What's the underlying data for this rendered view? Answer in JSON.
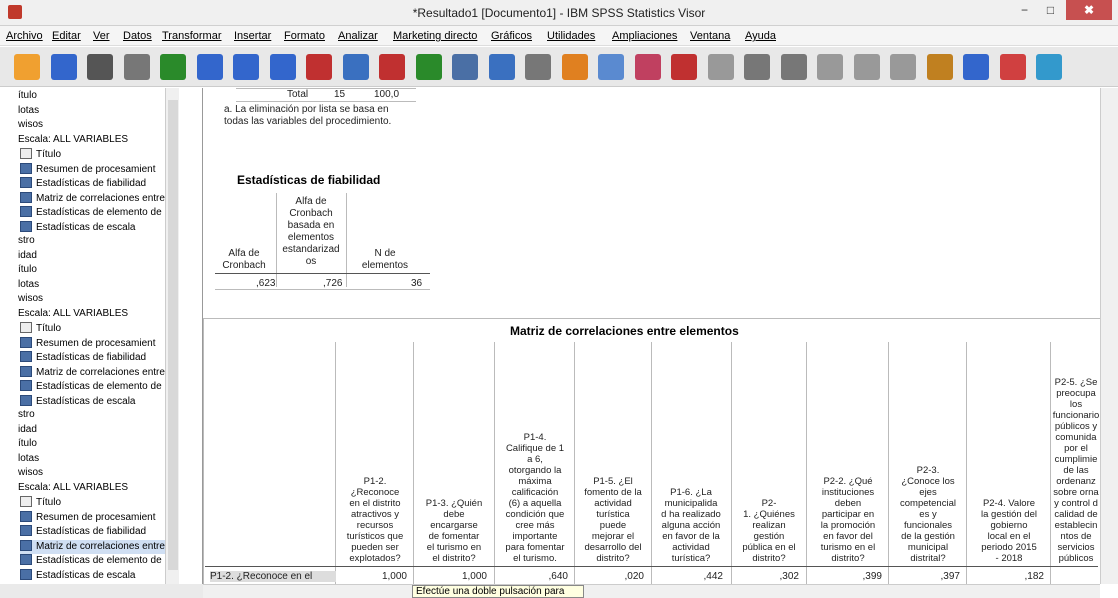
{
  "window": {
    "title": "*Resultado1 [Documento1] - IBM SPSS Statistics Visor",
    "btn_min": "−",
    "btn_max": "□",
    "btn_close": "✖"
  },
  "menu": [
    "Archivo",
    "Editar",
    "Ver",
    "Datos",
    "Transformar",
    "Insertar",
    "Formato",
    "Analizar",
    "Marketing directo",
    "Gráficos",
    "Utilidades",
    "Ampliaciones",
    "Ventana",
    "Ayuda"
  ],
  "toolbar_icons": [
    "open-icon",
    "save-icon",
    "print-icon",
    "print-preview-icon",
    "export-icon",
    "recall-dialog-icon",
    "undo-icon",
    "redo-icon",
    "goto-data-icon",
    "goto-case-icon",
    "goto-variable-icon",
    "variables-icon",
    "use-sets-icon",
    "show-all-icon",
    "insert-cases-icon",
    "designate-window-icon",
    "run-script-icon",
    "insert-output-icon",
    "insert-heading-icon",
    "insert-title-icon",
    "promote-icon",
    "demote-icon",
    "expand-icon",
    "collapse-icon",
    "show-icon",
    "hide-icon",
    "script-icon",
    "dialog-icon",
    "chart-icon"
  ],
  "nav": {
    "items": [
      {
        "label": "ítulo",
        "type": "text"
      },
      {
        "label": "lotas",
        "type": "text"
      },
      {
        "label": "wisos",
        "type": "text"
      },
      {
        "label": "Escala: ALL VARIABLES",
        "type": "text"
      },
      {
        "label": "Título",
        "type": "child"
      },
      {
        "label": "Resumen de procesamient",
        "type": "table"
      },
      {
        "label": "Estadísticas de fiabilidad",
        "type": "table"
      },
      {
        "label": "Matriz de correlaciones entre",
        "type": "table"
      },
      {
        "label": "Estadísticas de elemento de",
        "type": "table"
      },
      {
        "label": "Estadísticas de escala",
        "type": "table"
      },
      {
        "label": "stro",
        "type": "text"
      },
      {
        "label": "idad",
        "type": "text"
      },
      {
        "label": "ítulo",
        "type": "text"
      },
      {
        "label": "lotas",
        "type": "text"
      },
      {
        "label": "wisos",
        "type": "text"
      },
      {
        "label": "Escala: ALL VARIABLES",
        "type": "text"
      },
      {
        "label": "Título",
        "type": "child"
      },
      {
        "label": "Resumen de procesamient",
        "type": "table"
      },
      {
        "label": "Estadísticas de fiabilidad",
        "type": "table"
      },
      {
        "label": "Matriz de correlaciones entre",
        "type": "table"
      },
      {
        "label": "Estadísticas de elemento de",
        "type": "table"
      },
      {
        "label": "Estadísticas de escala",
        "type": "table"
      },
      {
        "label": "stro",
        "type": "text"
      },
      {
        "label": "idad",
        "type": "text"
      },
      {
        "label": "ítulo",
        "type": "text"
      },
      {
        "label": "lotas",
        "type": "text"
      },
      {
        "label": "wisos",
        "type": "text"
      },
      {
        "label": "Escala: ALL VARIABLES",
        "type": "text"
      },
      {
        "label": "Título",
        "type": "child"
      },
      {
        "label": "Resumen de procesamient",
        "type": "table"
      },
      {
        "label": "Estadísticas de fiabilidad",
        "type": "table"
      },
      {
        "label": "Matriz de correlaciones entre",
        "type": "table",
        "selected": true
      },
      {
        "label": "Estadísticas de elemento de",
        "type": "table"
      },
      {
        "label": "Estadísticas de escala",
        "type": "table"
      }
    ]
  },
  "summary": {
    "total_label": "Total",
    "total_n": "15",
    "total_pct": "100,0",
    "footnote": "a. La eliminación por lista se basa en todas las variables del procedimiento."
  },
  "reliability": {
    "title": "Estadísticas de fiabilidad",
    "col1": "Alfa de Cronbach",
    "col2": "Alfa de Cronbach basada en elementos estandarizad os",
    "col3": "N de elementos",
    "v1": ",623",
    "v2": ",726",
    "v3": "36"
  },
  "matrix": {
    "title": "Matriz de correlaciones entre elementos",
    "headers": [
      "P1-2.\n¿Reconoce\nen el distrito\natractivos y\nrecursos\nturísticos que\npueden ser\nexplotados?",
      "P1-3. ¿Quién\ndebe\nencargarse\nde fomentar\nel turismo en\nel distrito?",
      "P1-4.\nCalifique de 1\na 6,\notorgando la\nmáxima\ncalificación\n(6) a aquella\ncondición que\ncree más\nimportante\npara fomentar\nel turismo.",
      "P1-5. ¿El\nfomento de la\nactividad\nturística\npuede\nmejorar el\ndesarrollo del\ndistrito?",
      "P1-6. ¿La\nmunicipalida\nd ha realizado\nalguna acción\nen favor de la\nactividad\nturística?",
      "P2-\n1. ¿Quiénes\nrealizan\ngestión\npública en el\ndistrito?",
      "P2-2. ¿Qué\ninstituciones\ndeben\nparticipar en\nla promoción\nen favor del\nturismo en el\ndistrito?",
      "P2-3.\n¿Conoce los\nejes\ncompetencial\nes y\nfuncionales\nde la gestión\nmunicipal\ndistrital?",
      "P2-4. Valore\nla gestión del\ngobierno\nlocal en el\nperiodo 2015\n- 2018",
      "P2-5. ¿Se\npreocupa\nlos\nfuncionario\npúblicos y\ncomunida\npor el\ncumplimie\nde las\nordenanz\nsobre orna\ny control d\ncalidad de\nestablecin\nntos de\nservicios\npúblicos"
    ],
    "row_label": "P1-2. ¿Reconoce en el",
    "row_values": [
      "1,000",
      "1,000",
      ",640",
      ",020",
      ",442",
      ",302",
      ",399",
      ",397",
      ",182",
      ""
    ]
  },
  "tooltip": "Efectúe una doble pulsación para"
}
